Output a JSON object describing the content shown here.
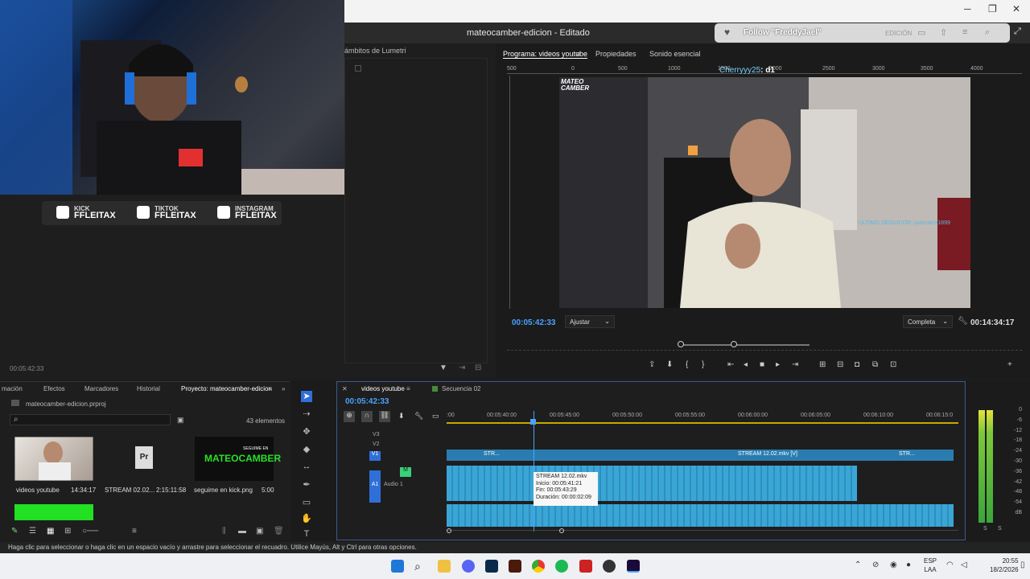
{
  "window": {
    "title": "mateocamber-edicion - Editado",
    "controls": [
      "─",
      "❐",
      "✕"
    ]
  },
  "webcam": {
    "social": [
      {
        "platform": "KICK",
        "handle": "FFLEITAX"
      },
      {
        "platform": "TIKTOK",
        "handle": "FFLEITAX"
      },
      {
        "platform": "INSTAGRAM",
        "handle": "FFLEITAX"
      }
    ]
  },
  "left_panel": {
    "tab": "ámbitos de Lumetri",
    "timecode": "00:05:42:33"
  },
  "program": {
    "tabs": [
      "Programa: videos youtube",
      "Propiedades",
      "Sonido esencial"
    ],
    "ruler_ticks": [
      "500",
      "0",
      "500",
      "1000",
      "1500",
      "2000",
      "2500",
      "3000",
      "3500",
      "4000"
    ],
    "overlay_user": "Cherryyy25",
    "overlay_msg": ": d1",
    "video_logo": "MATEO CAMBER",
    "video_caption": "ULTIMO SEGUIDOR: juancarra1899",
    "timecode": "00:05:42:33",
    "fit": "Ajustar",
    "quality": "Completa",
    "duration": "00:14:34:17"
  },
  "follow": {
    "text": "Follow \"FreddyJael\"",
    "edicion": "EDICIÓN"
  },
  "project": {
    "tabs": [
      "mación",
      "Efectos",
      "Marcadores",
      "Historial",
      "Proyecto: mateocamber-edicion"
    ],
    "file": "mateocamber-edicion.prproj",
    "count": "43 elementos",
    "items": [
      {
        "name": "videos youtube",
        "duration": "14:34:17"
      },
      {
        "name": "STREAM 02.02...",
        "duration": "2:15:11:58"
      },
      {
        "name": "seguime en kick.png",
        "duration": "5:00"
      }
    ],
    "kick_label": "MATEOCAMBER",
    "kick_small": "SEGUIME EN"
  },
  "timeline": {
    "tabs": [
      "videos youtube",
      "Secuencia 02"
    ],
    "timecode": "00:05:42:33",
    "ruler": [
      ":00",
      "00:05:40:00",
      "00:05:45:00",
      "00:05:50:00",
      "00:05:55:00",
      "00:06:00:00",
      "00:06:05:00",
      "00:06:10:00",
      "00:06:15:0"
    ],
    "tracks": [
      "V3",
      "V2",
      "V1",
      "A1",
      "Audio 1"
    ],
    "clip_label": "STREAM 12.02.mkv [V]",
    "clip_short": "STR...",
    "tooltip": {
      "name": "STREAM 12.02.mkv",
      "inicio": "Inicio: 00:05:41:21",
      "fin": "Fin: 00:05:43:29",
      "duracion": "Duración: 00:00:02:09"
    }
  },
  "meters": {
    "scale": [
      "0",
      "-6",
      "-12",
      "-18",
      "-24",
      "-30",
      "-36",
      "-42",
      "-48",
      "-54",
      "dB"
    ],
    "footer": [
      "S",
      "S"
    ]
  },
  "status": "Haga clic para seleccionar o haga clic en un espacio vacío y arrastre para seleccionar el recuadro. Utilice Mayús, Alt y Ctrl para otras opciones.",
  "taskbar": {
    "lang1": "ESP",
    "lang2": "LAA",
    "time": "20:55",
    "date": "18/2/2026"
  }
}
